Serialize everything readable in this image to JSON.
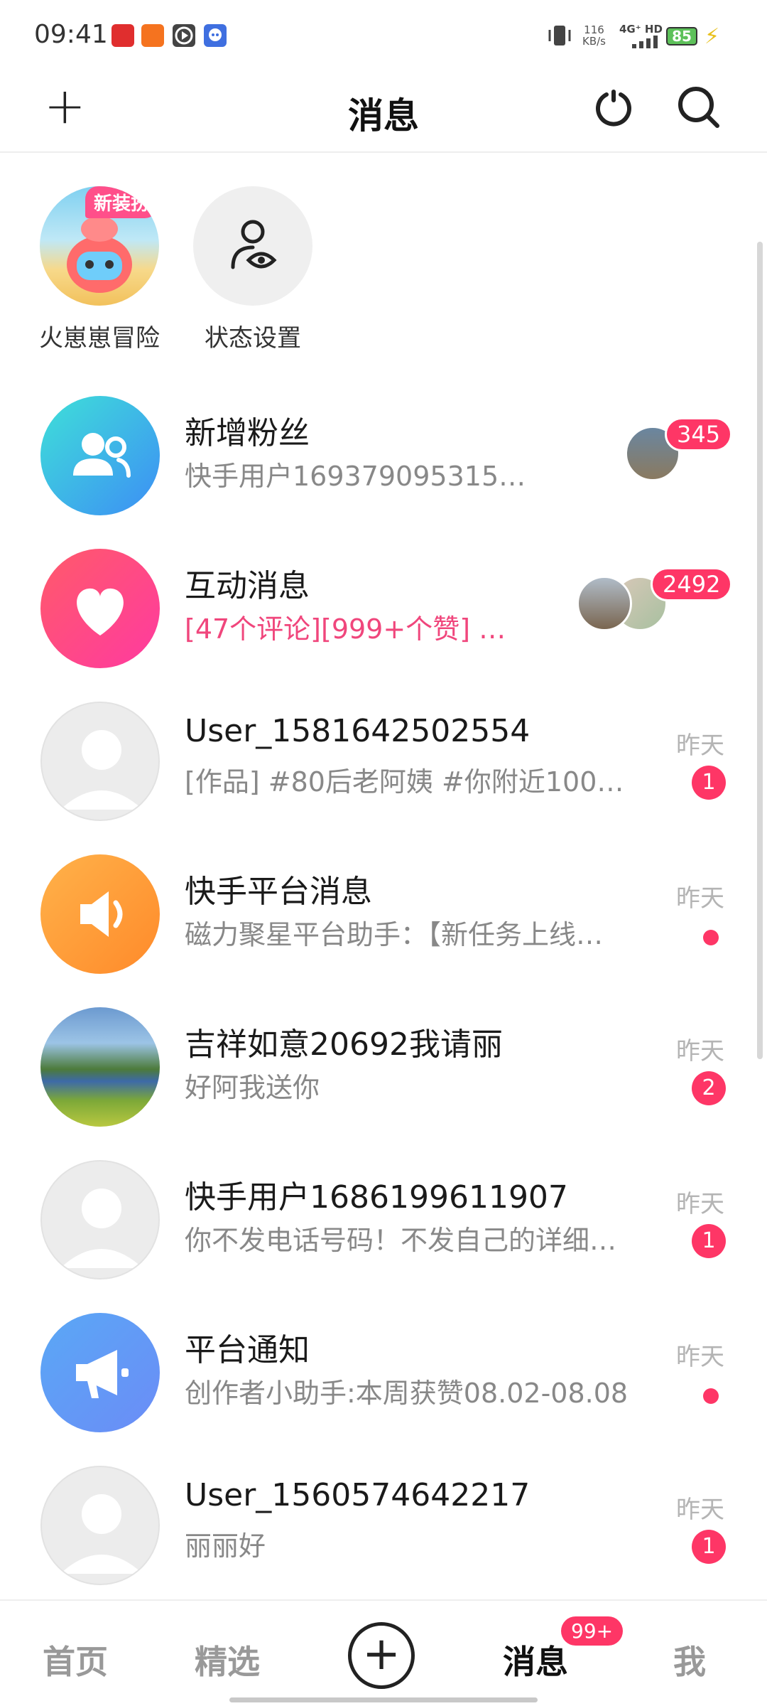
{
  "status_bar": {
    "time": "09:41",
    "net_speed": "116",
    "net_unit": "KB/s",
    "network": "4G⁺ HD",
    "battery": "85",
    "icons": [
      "app-icon-red",
      "app-icon-orange",
      "play-icon",
      "chat-icon",
      "vibrate-icon",
      "signal-icon",
      "charging-icon"
    ]
  },
  "header": {
    "plus": "+",
    "title": "消息",
    "icons": [
      "refresh-icon",
      "search-icon"
    ]
  },
  "stories": [
    {
      "label": "火崽崽冒险",
      "tag": "新装扮"
    },
    {
      "label": "状态设置"
    }
  ],
  "messages": [
    {
      "title": "新增粉丝",
      "subtitle": "快手用户169379095315…",
      "count": "345",
      "icon": "followers-icon"
    },
    {
      "title": "互动消息",
      "subtitle": "[47个评论][999+个赞] …",
      "count": "2492",
      "icon": "heart-icon"
    },
    {
      "title": "User_1581642502554",
      "subtitle": "[作品] #80后老阿姨 #你附近100…",
      "time": "昨天",
      "badge": "1"
    },
    {
      "title": "快手平台消息",
      "subtitle": "磁力聚星平台助手：【新任务上线…",
      "time": "昨天",
      "icon": "speaker-icon"
    },
    {
      "title": "吉祥如意20692我请丽",
      "subtitle": "好阿我送你",
      "time": "昨天",
      "badge": "2"
    },
    {
      "title": "快手用户1686199611907",
      "subtitle": "你不发电话号码！不发自己的详细…",
      "time": "昨天",
      "badge": "1"
    },
    {
      "title": "平台通知",
      "subtitle": "创作者小助手:本周获赞08.02-08.08",
      "time": "昨天",
      "icon": "megaphone-icon"
    },
    {
      "title": "User_1560574642217",
      "subtitle": "丽丽好",
      "time": "昨天",
      "badge": "1"
    }
  ],
  "tabs": [
    {
      "label": "首页"
    },
    {
      "label": "精选"
    },
    {
      "label": "+"
    },
    {
      "label": "消息",
      "badge": "99+"
    },
    {
      "label": "我"
    }
  ],
  "colors": {
    "accent": "#fe3666",
    "pink_text": "#f0467c"
  }
}
